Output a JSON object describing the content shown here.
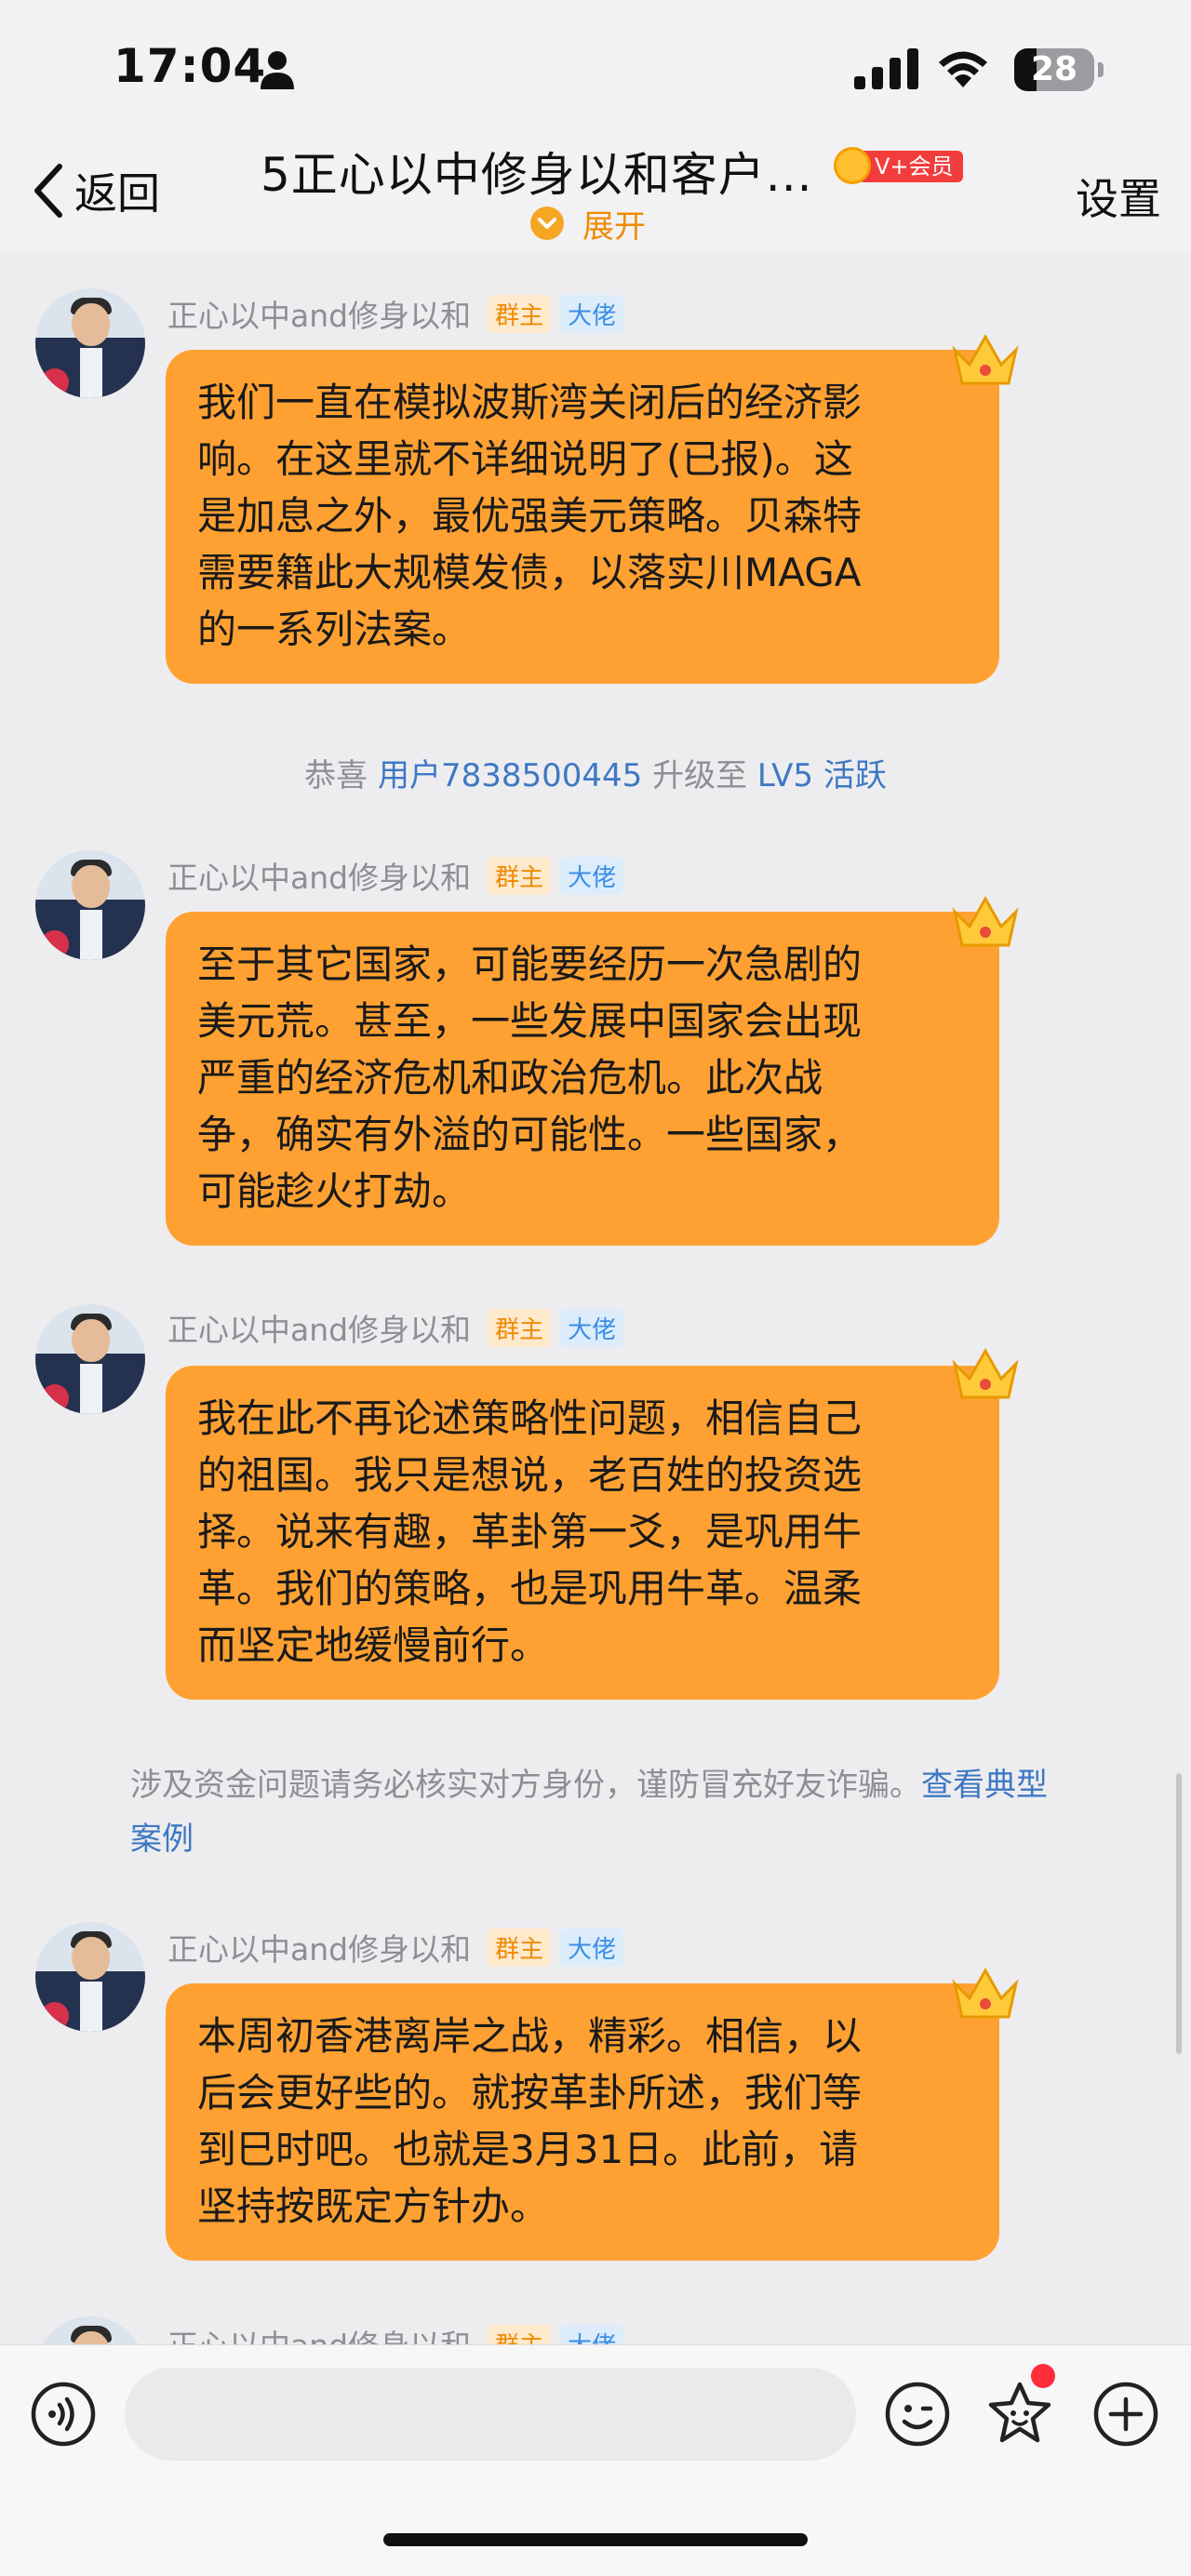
{
  "status_bar": {
    "time": "17:04",
    "battery_level": "28",
    "icons": [
      "person-icon",
      "signal-icon",
      "wifi-icon",
      "battery-icon"
    ]
  },
  "nav": {
    "back_label": "返回",
    "title": "5正心以中修身以和客户...",
    "vip_label": "V+会员",
    "expand_label": "展开",
    "settings_label": "设置"
  },
  "messages": [
    {
      "sender": "正心以中and修身以和",
      "tag_owner": "群主",
      "tag_vip": "大佬",
      "text": "我们一直在模拟波斯湾关闭后的经济影\n响。在这里就不详细说明了(已报)。这\n是加息之外，最优强美元策略。贝森特\n需要籍此大规模发债，以落实川MAGA\n的一系列法案。"
    },
    {
      "sender": "正心以中and修身以和",
      "tag_owner": "群主",
      "tag_vip": "大佬",
      "text": "至于其它国家，可能要经历一次急剧的\n美元荒。甚至，一些发展中国家会出现\n严重的经济危机和政治危机。此次战\n争，确实有外溢的可能性。一些国家，\n可能趁火打劫。"
    },
    {
      "sender": "正心以中and修身以和",
      "tag_owner": "群主",
      "tag_vip": "大佬",
      "text": "我在此不再论述策略性问题，相信自己\n的祖国。我只是想说，老百姓的投资选\n择。说来有趣，革卦第一爻，是巩用牛\n革。我们的策略，也是巩用牛革。温柔\n而坚定地缓慢前行。"
    },
    {
      "sender": "正心以中and修身以和",
      "tag_owner": "群主",
      "tag_vip": "大佬",
      "text": "本周初香港离岸之战，精彩。相信，以\n后会更好些的。就按革卦所述，我们等\n到巳时吧。也就是3月31日。此前，请\n坚持按既定方针办。"
    },
    {
      "sender": "正心以中and修身以和",
      "tag_owner": "群主",
      "tag_vip": "大佬"
    }
  ],
  "system_notice": {
    "prefix": "恭喜",
    "user": "用户7838500445",
    "middle": "升级至",
    "level": "LV5 活跃"
  },
  "warning_notice": {
    "text": "涉及资金问题请务必核实对方身份，谨防冒充好友诈骗。",
    "link": "查看典型案例"
  },
  "input_bar": {
    "placeholder": "",
    "icons": [
      "voice-icon",
      "emoji-icon",
      "sticker-icon",
      "plus-icon"
    ]
  }
}
